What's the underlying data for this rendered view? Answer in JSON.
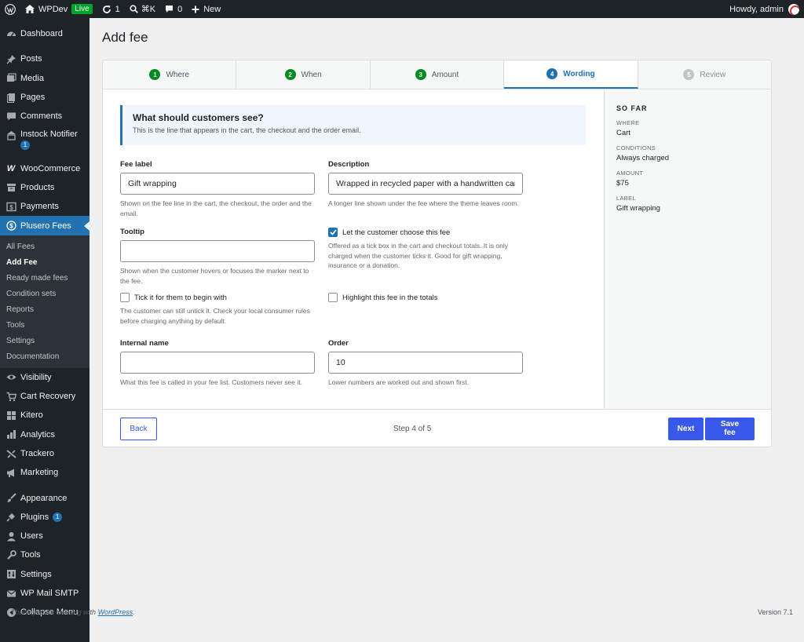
{
  "adminbar": {
    "site_name": "WPDev",
    "live_label": "Live",
    "updates_count": "1",
    "search_shortcut": "⌘K",
    "comments_count": "0",
    "new_label": "New",
    "greeting": "Howdy, admin"
  },
  "sidebar": {
    "dashboard": "Dashboard",
    "posts": "Posts",
    "media": "Media",
    "pages": "Pages",
    "comments": "Comments",
    "instock_notifier": "Instock Notifier",
    "instock_badge": "1",
    "woocommerce": "WooCommerce",
    "products": "Products",
    "payments": "Payments",
    "plusero_fees": "Plusero Fees",
    "submenu": {
      "all_fees": "All Fees",
      "add_fee": "Add Fee",
      "ready_made_fees": "Ready made fees",
      "condition_sets": "Condition sets",
      "reports": "Reports",
      "tools": "Tools",
      "settings": "Settings",
      "documentation": "Documentation"
    },
    "visibility": "Visibility",
    "cart_recovery": "Cart Recovery",
    "kitero": "Kitero",
    "analytics": "Analytics",
    "trackero": "Trackero",
    "marketing": "Marketing",
    "appearance": "Appearance",
    "plugins": "Plugins",
    "plugins_badge": "1",
    "users": "Users",
    "tools": "Tools",
    "settings": "Settings",
    "wp_mail_smtp": "WP Mail SMTP",
    "collapse": "Collapse Menu"
  },
  "page": {
    "title": "Add fee"
  },
  "steps": [
    {
      "num": "1",
      "label": "Where"
    },
    {
      "num": "2",
      "label": "When"
    },
    {
      "num": "3",
      "label": "Amount"
    },
    {
      "num": "4",
      "label": "Wording"
    },
    {
      "num": "5",
      "label": "Review"
    }
  ],
  "notice": {
    "title": "What should customers see?",
    "subtitle": "This is the line that appears in the cart, the checkout and the order email."
  },
  "form": {
    "fee_label": {
      "label": "Fee label",
      "value": "Gift wrapping",
      "hint": "Shown on the fee line in the cart, the checkout, the order and the email."
    },
    "description": {
      "label": "Description",
      "value": "Wrapped in recycled paper with a handwritten car",
      "hint": "A longer line shown under the fee where the theme leaves room."
    },
    "tooltip": {
      "label": "Tooltip",
      "value": "",
      "hint": "Shown when the customer hovers or focuses the marker next to the fee."
    },
    "customer_choose": {
      "label": "Let the customer choose this fee",
      "hint": "Offered as a tick box in the cart and checkout totals. It is only charged when the customer ticks it. Good for gift wrapping, insurance or a donation."
    },
    "tick_default": {
      "label": "Tick it for them to begin with",
      "hint": "The customer can still untick it. Check your local consumer rules before charging anything by default."
    },
    "highlight": {
      "label": "Highlight this fee in the totals"
    },
    "internal_name": {
      "label": "Internal name",
      "value": "",
      "hint": "What this fee is called in your fee list. Customers never see it."
    },
    "order": {
      "label": "Order",
      "value": "10",
      "hint": "Lower numbers are worked out and shown first."
    }
  },
  "summary": {
    "title": "SO FAR",
    "where_key": "WHERE",
    "where_val": "Cart",
    "conditions_key": "CONDITIONS",
    "conditions_val": "Always charged",
    "amount_key": "AMOUNT",
    "amount_val": "$75",
    "label_key": "LABEL",
    "label_val": "Gift wrapping"
  },
  "footer_bar": {
    "back": "Back",
    "step_text": "Step 4 of 5",
    "next": "Next",
    "save": "Save fee"
  },
  "wp_footer": {
    "thanks_prefix": "Thank you for creating with ",
    "wordpress_link": "WordPress",
    "thanks_suffix": ".",
    "version": "Version 7.1"
  },
  "colors": {
    "accent": "#2271b1",
    "primary_button": "#3858e9",
    "done_step": "#008a20",
    "sidebar_bg": "#1d2327"
  }
}
